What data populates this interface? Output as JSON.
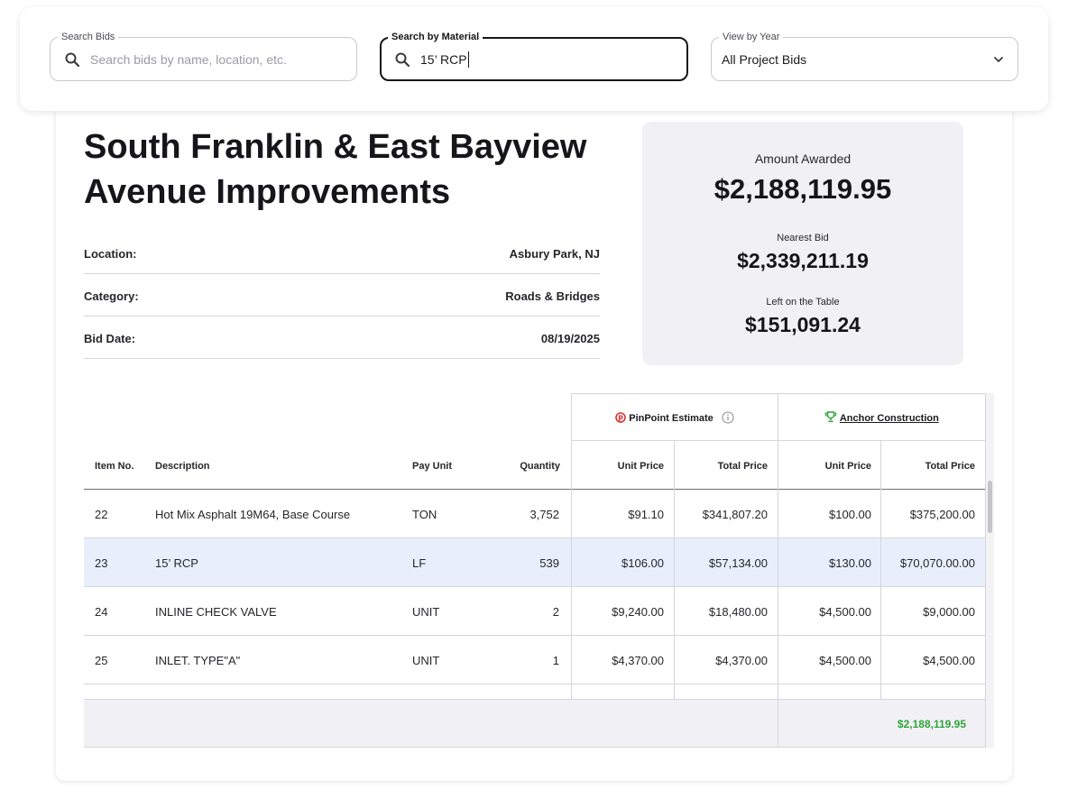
{
  "filters": {
    "search_bids": {
      "label": "Search Bids",
      "placeholder": "Search bids by name, location, etc."
    },
    "search_material": {
      "label": "Search by Material",
      "value": "15’ RCP"
    },
    "view_year": {
      "label": "View by Year",
      "selected": "All Project Bids"
    }
  },
  "project": {
    "title_line1": "South Franklin & East Bayview",
    "title_line2": "Avenue Improvements",
    "info": [
      {
        "key": "Location:",
        "value": "Asbury Park, NJ"
      },
      {
        "key": "Category:",
        "value": "Roads & Bridges"
      },
      {
        "key": "Bid Date:",
        "value": "08/19/2025"
      }
    ]
  },
  "award": {
    "amount_label": "Amount Awarded",
    "amount": "$2,188,119.95",
    "nearest_label": "Nearest Bid",
    "nearest": "$2,339,211.19",
    "left_label": "Left on the Table",
    "left": "$151,091.24"
  },
  "table": {
    "group_estimate": "PinPoint Estimate",
    "group_winner": "Anchor Construction",
    "headers": {
      "item_no": "Item No.",
      "description": "Description",
      "pay_unit": "Pay Unit",
      "quantity": "Quantity",
      "unit_price": "Unit Price",
      "total_price": "Total Price"
    },
    "rows": [
      {
        "item": "22",
        "desc": "Hot Mix Asphalt 19M64, Base Course",
        "unit": "TON",
        "qty": "3,752",
        "est_unit": "$91.10",
        "est_total": "$341,807.20",
        "win_unit": "$100.00",
        "win_total": "$375,200.00"
      },
      {
        "item": "23",
        "desc": "15’ RCP",
        "unit": "LF",
        "qty": "539",
        "est_unit": "$106.00",
        "est_total": "$57,134.00",
        "win_unit": "$130.00",
        "win_total": "$70,070.00.00"
      },
      {
        "item": "24",
        "desc": "INLINE CHECK VALVE",
        "unit": "UNIT",
        "qty": "2",
        "est_unit": "$9,240.00",
        "est_total": "$18,480.00",
        "win_unit": "$4,500.00",
        "win_total": "$9,000.00"
      },
      {
        "item": "25",
        "desc": "INLET. TYPE\"A\"",
        "unit": "UNIT",
        "qty": "1",
        "est_unit": "$4,370.00",
        "est_total": "$4,370.00",
        "win_unit": "$4,500.00",
        "win_total": "$4,500.00"
      }
    ],
    "footer_total": "$2,188,119.95"
  },
  "colors": {
    "highlight_row": "#e8effb",
    "total_green": "#2fa33a",
    "pinpoint_red": "#e0312f",
    "trophy_green": "#2fa33a"
  },
  "icons": [
    "search-icon",
    "chevron-down-icon",
    "pinpoint-logo-icon",
    "info-icon",
    "trophy-icon"
  ]
}
